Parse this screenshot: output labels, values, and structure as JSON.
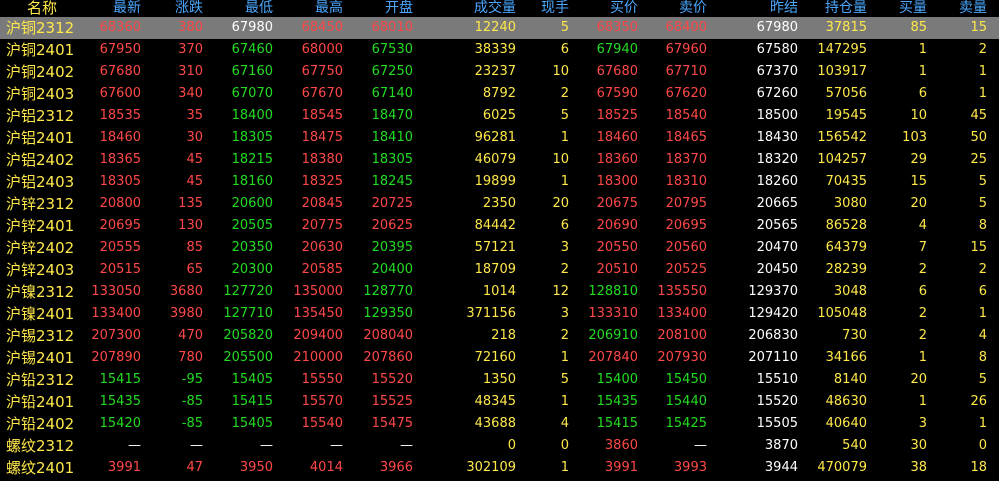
{
  "headers": [
    "名称",
    "最新",
    "涨跌",
    "最低",
    "最高",
    "开盘",
    "成交量",
    "现手",
    "买价",
    "卖价",
    "昨结",
    "持仓量",
    "买量",
    "卖量"
  ],
  "colors": {
    "up": "#ff4848",
    "down": "#22dc22",
    "flat": "#ffffff",
    "yellow": "#ffe84a",
    "header": "#4aa8ff",
    "selected_row": "#7a7a7a"
  },
  "rows": [
    {
      "name": "沪铜2312",
      "last": "68360",
      "change": "380",
      "low": "67980",
      "high": "68450",
      "open": "68010",
      "volume": "12240",
      "cur": "5",
      "bid": "68350",
      "ask": "68400",
      "prev": "67980",
      "oi": "37815",
      "bidvol": "85",
      "askvol": "15"
    },
    {
      "name": "沪铜2401",
      "last": "67950",
      "change": "370",
      "low": "67460",
      "high": "68000",
      "open": "67530",
      "volume": "38339",
      "cur": "6",
      "bid": "67940",
      "ask": "67960",
      "prev": "67580",
      "oi": "147295",
      "bidvol": "1",
      "askvol": "2"
    },
    {
      "name": "沪铜2402",
      "last": "67680",
      "change": "310",
      "low": "67160",
      "high": "67750",
      "open": "67250",
      "volume": "23237",
      "cur": "10",
      "bid": "67680",
      "ask": "67710",
      "prev": "67370",
      "oi": "103917",
      "bidvol": "1",
      "askvol": "1"
    },
    {
      "name": "沪铜2403",
      "last": "67600",
      "change": "340",
      "low": "67070",
      "high": "67670",
      "open": "67140",
      "volume": "8792",
      "cur": "2",
      "bid": "67590",
      "ask": "67620",
      "prev": "67260",
      "oi": "57056",
      "bidvol": "6",
      "askvol": "1"
    },
    {
      "name": "沪铝2312",
      "last": "18535",
      "change": "35",
      "low": "18400",
      "high": "18545",
      "open": "18470",
      "volume": "6025",
      "cur": "5",
      "bid": "18525",
      "ask": "18540",
      "prev": "18500",
      "oi": "19545",
      "bidvol": "10",
      "askvol": "45"
    },
    {
      "name": "沪铝2401",
      "last": "18460",
      "change": "30",
      "low": "18305",
      "high": "18475",
      "open": "18410",
      "volume": "96281",
      "cur": "1",
      "bid": "18460",
      "ask": "18465",
      "prev": "18430",
      "oi": "156542",
      "bidvol": "103",
      "askvol": "50"
    },
    {
      "name": "沪铝2402",
      "last": "18365",
      "change": "45",
      "low": "18215",
      "high": "18380",
      "open": "18305",
      "volume": "46079",
      "cur": "10",
      "bid": "18360",
      "ask": "18370",
      "prev": "18320",
      "oi": "104257",
      "bidvol": "29",
      "askvol": "25"
    },
    {
      "name": "沪铝2403",
      "last": "18305",
      "change": "45",
      "low": "18160",
      "high": "18325",
      "open": "18245",
      "volume": "19899",
      "cur": "1",
      "bid": "18300",
      "ask": "18310",
      "prev": "18260",
      "oi": "70435",
      "bidvol": "15",
      "askvol": "5"
    },
    {
      "name": "沪锌2312",
      "last": "20800",
      "change": "135",
      "low": "20600",
      "high": "20845",
      "open": "20725",
      "volume": "2350",
      "cur": "20",
      "bid": "20675",
      "ask": "20795",
      "prev": "20665",
      "oi": "3080",
      "bidvol": "20",
      "askvol": "5"
    },
    {
      "name": "沪锌2401",
      "last": "20695",
      "change": "130",
      "low": "20505",
      "high": "20775",
      "open": "20625",
      "volume": "84442",
      "cur": "6",
      "bid": "20690",
      "ask": "20695",
      "prev": "20565",
      "oi": "86528",
      "bidvol": "4",
      "askvol": "8"
    },
    {
      "name": "沪锌2402",
      "last": "20555",
      "change": "85",
      "low": "20350",
      "high": "20630",
      "open": "20395",
      "volume": "57121",
      "cur": "3",
      "bid": "20550",
      "ask": "20560",
      "prev": "20470",
      "oi": "64379",
      "bidvol": "7",
      "askvol": "15"
    },
    {
      "name": "沪锌2403",
      "last": "20515",
      "change": "65",
      "low": "20300",
      "high": "20585",
      "open": "20400",
      "volume": "18709",
      "cur": "2",
      "bid": "20510",
      "ask": "20525",
      "prev": "20450",
      "oi": "28239",
      "bidvol": "2",
      "askvol": "2"
    },
    {
      "name": "沪镍2312",
      "last": "133050",
      "change": "3680",
      "low": "127720",
      "high": "135000",
      "open": "128770",
      "volume": "1014",
      "cur": "12",
      "bid": "128810",
      "ask": "135550",
      "prev": "129370",
      "oi": "3048",
      "bidvol": "6",
      "askvol": "6"
    },
    {
      "name": "沪镍2401",
      "last": "133400",
      "change": "3980",
      "low": "127710",
      "high": "135450",
      "open": "129350",
      "volume": "371156",
      "cur": "3",
      "bid": "133310",
      "ask": "133400",
      "prev": "129420",
      "oi": "105048",
      "bidvol": "2",
      "askvol": "1"
    },
    {
      "name": "沪锡2312",
      "last": "207300",
      "change": "470",
      "low": "205820",
      "high": "209400",
      "open": "208040",
      "volume": "218",
      "cur": "2",
      "bid": "206910",
      "ask": "208100",
      "prev": "206830",
      "oi": "730",
      "bidvol": "2",
      "askvol": "4"
    },
    {
      "name": "沪锡2401",
      "last": "207890",
      "change": "780",
      "low": "205500",
      "high": "210000",
      "open": "207860",
      "volume": "72160",
      "cur": "1",
      "bid": "207840",
      "ask": "207930",
      "prev": "207110",
      "oi": "34166",
      "bidvol": "1",
      "askvol": "8"
    },
    {
      "name": "沪铅2312",
      "last": "15415",
      "change": "-95",
      "low": "15405",
      "high": "15550",
      "open": "15520",
      "volume": "1350",
      "cur": "5",
      "bid": "15400",
      "ask": "15450",
      "prev": "15510",
      "oi": "8140",
      "bidvol": "20",
      "askvol": "5"
    },
    {
      "name": "沪铅2401",
      "last": "15435",
      "change": "-85",
      "low": "15415",
      "high": "15570",
      "open": "15525",
      "volume": "48345",
      "cur": "1",
      "bid": "15435",
      "ask": "15440",
      "prev": "15520",
      "oi": "48630",
      "bidvol": "1",
      "askvol": "26"
    },
    {
      "name": "沪铅2402",
      "last": "15420",
      "change": "-85",
      "low": "15405",
      "high": "15540",
      "open": "15475",
      "volume": "43688",
      "cur": "4",
      "bid": "15415",
      "ask": "15425",
      "prev": "15505",
      "oi": "40640",
      "bidvol": "3",
      "askvol": "1"
    },
    {
      "name": "螺纹2312",
      "last": "—",
      "change": "—",
      "low": "—",
      "high": "—",
      "open": "—",
      "volume": "0",
      "cur": "0",
      "bid": "3860",
      "ask": "—",
      "prev": "3870",
      "oi": "540",
      "bidvol": "30",
      "askvol": "0"
    },
    {
      "name": "螺纹2401",
      "last": "3991",
      "change": "47",
      "low": "3950",
      "high": "4014",
      "open": "3966",
      "volume": "302109",
      "cur": "1",
      "bid": "3991",
      "ask": "3993",
      "prev": "3944",
      "oi": "470079",
      "bidvol": "38",
      "askvol": "18"
    }
  ],
  "row_colors": [
    [
      "up",
      "up",
      "flat",
      "up",
      "up"
    ],
    [
      "up",
      "up",
      "down",
      "up",
      "down"
    ],
    [
      "up",
      "up",
      "down",
      "up",
      "down"
    ],
    [
      "up",
      "up",
      "down",
      "up",
      "down"
    ],
    [
      "up",
      "up",
      "down",
      "up",
      "down"
    ],
    [
      "up",
      "up",
      "down",
      "up",
      "down"
    ],
    [
      "up",
      "up",
      "down",
      "up",
      "down"
    ],
    [
      "up",
      "up",
      "down",
      "up",
      "down"
    ],
    [
      "up",
      "up",
      "down",
      "up",
      "up"
    ],
    [
      "up",
      "up",
      "down",
      "up",
      "up"
    ],
    [
      "up",
      "up",
      "down",
      "up",
      "down"
    ],
    [
      "up",
      "up",
      "down",
      "up",
      "down"
    ],
    [
      "up",
      "up",
      "down",
      "up",
      "down"
    ],
    [
      "up",
      "up",
      "down",
      "up",
      "down"
    ],
    [
      "up",
      "up",
      "down",
      "up",
      "up"
    ],
    [
      "up",
      "up",
      "down",
      "up",
      "up"
    ],
    [
      "down",
      "down",
      "down",
      "up",
      "up"
    ],
    [
      "down",
      "down",
      "down",
      "up",
      "up"
    ],
    [
      "down",
      "down",
      "down",
      "up",
      "up"
    ],
    [
      "flat",
      "flat",
      "flat",
      "flat",
      "flat"
    ],
    [
      "up",
      "up",
      "up",
      "up",
      "up"
    ]
  ],
  "quote_colors": [
    [
      "up",
      "up"
    ],
    [
      "down",
      "up"
    ],
    [
      "up",
      "up"
    ],
    [
      "up",
      "up"
    ],
    [
      "up",
      "up"
    ],
    [
      "up",
      "up"
    ],
    [
      "up",
      "up"
    ],
    [
      "up",
      "up"
    ],
    [
      "up",
      "up"
    ],
    [
      "up",
      "up"
    ],
    [
      "up",
      "up"
    ],
    [
      "up",
      "up"
    ],
    [
      "down",
      "up"
    ],
    [
      "up",
      "up"
    ],
    [
      "down",
      "up"
    ],
    [
      "up",
      "up"
    ],
    [
      "down",
      "down"
    ],
    [
      "down",
      "down"
    ],
    [
      "down",
      "down"
    ],
    [
      "up",
      "flat"
    ],
    [
      "up",
      "up"
    ]
  ]
}
